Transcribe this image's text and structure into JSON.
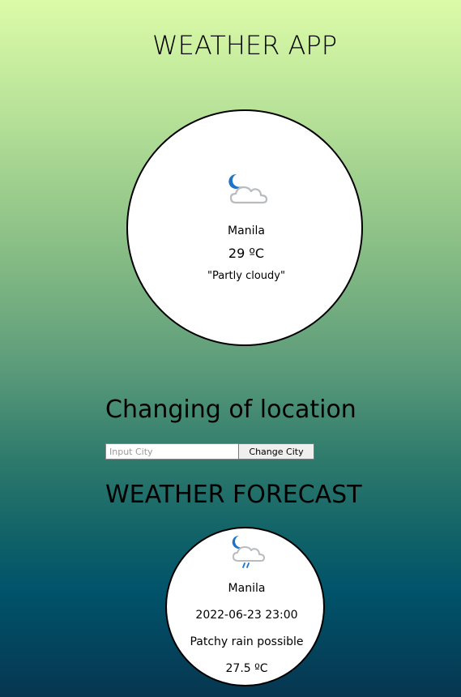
{
  "header": {
    "title": "WEATHER APP"
  },
  "current": {
    "icon": "moon-partly-cloudy-icon",
    "city": "Manila",
    "temperature": "29 ºC",
    "condition": "\"Partly cloudy\""
  },
  "location": {
    "title": "Changing of location",
    "input_placeholder": "Input City",
    "input_value": "",
    "button_label": "Change City"
  },
  "forecast": {
    "title": "WEATHER FORECAST",
    "items": [
      {
        "icon": "moon-cloud-rain-icon",
        "city": "Manila",
        "datetime": "2022-06-23 23:00",
        "condition": "Patchy rain possible",
        "temperature": "27.5 ºC"
      }
    ]
  },
  "colors": {
    "gradient_top": "#dcfba8",
    "gradient_bottom": "#073650",
    "card_background": "#ffffff",
    "icon_blue": "#1b74c9",
    "cloud_gray": "#b9bcbf"
  }
}
